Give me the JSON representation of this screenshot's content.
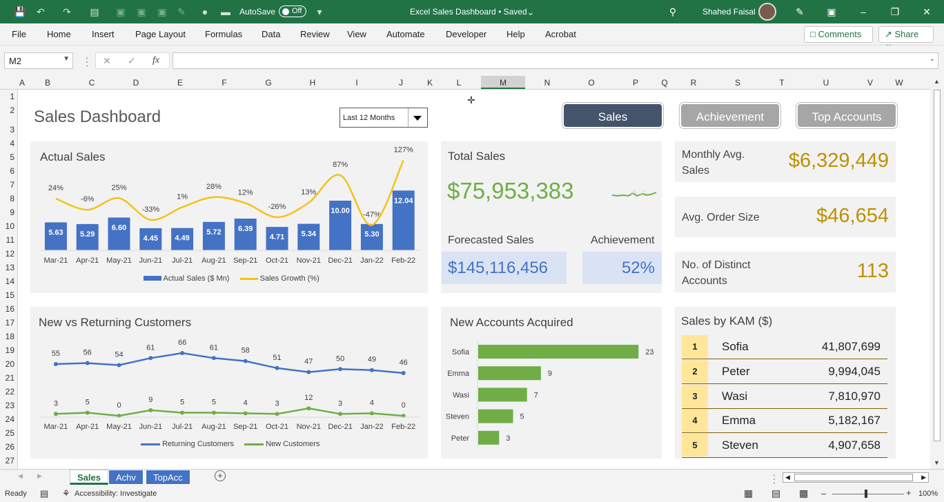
{
  "titlebar": {
    "autosave_label": "AutoSave",
    "autosave_state": "Off",
    "title": "Excel Sales Dashboard • Saved",
    "user": "Shahed Faisal"
  },
  "menu": [
    "File",
    "Home",
    "Insert",
    "Page Layout",
    "Formulas",
    "Data",
    "Review",
    "View",
    "Automate",
    "Developer",
    "Help",
    "Acrobat"
  ],
  "comments_label": "Comments",
  "share_label": "Share",
  "namebox": "M2",
  "fx_label": "fx",
  "columns": [
    "A",
    "B",
    "C",
    "D",
    "E",
    "F",
    "G",
    "H",
    "I",
    "J",
    "K",
    "L",
    "M",
    "N",
    "O",
    "P",
    "Q",
    "R",
    "S",
    "T",
    "U",
    "V",
    "W"
  ],
  "rows": [
    "1",
    "2",
    "3",
    "4",
    "5",
    "6",
    "7",
    "8",
    "9",
    "10",
    "11",
    "12",
    "13",
    "14",
    "15",
    "16",
    "17",
    "18",
    "19",
    "20",
    "21",
    "22",
    "23",
    "24",
    "25",
    "26",
    "27"
  ],
  "dashboard": {
    "title": "Sales Dashboard",
    "period": "Last 12 Months",
    "nav": [
      "Sales",
      "Achievement",
      "Top Accounts"
    ]
  },
  "actual_sales": {
    "title": "Actual Sales",
    "legend_bar": "Actual Sales ($ Mn)",
    "legend_line": "Sales Growth (%)"
  },
  "total": {
    "title": "Total Sales",
    "value": "$75,953,383",
    "forecast_label": "Forecasted Sales",
    "forecast_value": "$145,116,456",
    "achievement_label": "Achievement",
    "achievement_value": "52%"
  },
  "kpis": [
    {
      "label": "Monthly Avg. Sales",
      "value": "$6,329,449"
    },
    {
      "label": "Avg. Order Size",
      "value": "$46,654"
    },
    {
      "label": "No. of Distinct Accounts",
      "value": "113"
    }
  ],
  "customers": {
    "title": "New vs Returning Customers",
    "legend_returning": "Returning Customers",
    "legend_new": "New Customers"
  },
  "accounts": {
    "title": "New Accounts Acquired"
  },
  "kam": {
    "title": "Sales by KAM ($)",
    "rows": [
      {
        "rank": "1",
        "name": "Sofia",
        "value": "41,807,699"
      },
      {
        "rank": "2",
        "name": "Peter",
        "value": "9,994,045"
      },
      {
        "rank": "3",
        "name": "Wasi",
        "value": "7,810,970"
      },
      {
        "rank": "4",
        "name": "Emma",
        "value": "5,182,167"
      },
      {
        "rank": "5",
        "name": "Steven",
        "value": "4,907,658"
      }
    ]
  },
  "sheet_tabs": [
    "Sales",
    "Achv",
    "TopAcc"
  ],
  "status": {
    "ready": "Ready",
    "accessibility": "Accessibility: Investigate",
    "zoom": "100%"
  },
  "chart_data": [
    {
      "type": "bar",
      "title": "Actual Sales",
      "categories": [
        "Mar-21",
        "Apr-21",
        "May-21",
        "Jun-21",
        "Jul-21",
        "Aug-21",
        "Sep-21",
        "Oct-21",
        "Nov-21",
        "Dec-21",
        "Jan-22",
        "Feb-22"
      ],
      "series": [
        {
          "name": "Actual Sales ($ Mn)",
          "kind": "bar",
          "values": [
            5.63,
            5.29,
            6.6,
            4.45,
            4.49,
            5.72,
            6.39,
            4.71,
            5.34,
            10.0,
            5.3,
            12.04
          ],
          "color": "#4472c4"
        },
        {
          "name": "Sales Growth (%)",
          "kind": "line",
          "values": [
            24,
            -6,
            25,
            -33,
            1,
            28,
            12,
            -26,
            13,
            87,
            -47,
            127
          ],
          "labels": [
            "24%",
            "-6%",
            "25%",
            "-33%",
            "1%",
            "28%",
            "12%",
            "-26%",
            "13%",
            "87%",
            "-47%",
            "127%"
          ],
          "color": "#f2c318"
        }
      ]
    },
    {
      "type": "line",
      "title": "New vs Returning Customers",
      "categories": [
        "Mar-21",
        "Apr-21",
        "May-21",
        "Jun-21",
        "Jul-21",
        "Aug-21",
        "Sep-21",
        "Oct-21",
        "Nov-21",
        "Dec-21",
        "Jan-22",
        "Feb-22"
      ],
      "series": [
        {
          "name": "Returning Customers",
          "values": [
            55,
            56,
            54,
            61,
            66,
            61,
            58,
            51,
            47,
            50,
            49,
            46
          ],
          "color": "#4472c4"
        },
        {
          "name": "New Customers",
          "values": [
            3,
            5,
            0,
            9,
            5,
            5,
            4,
            3,
            12,
            3,
            4,
            0
          ],
          "color": "#70ad47"
        }
      ]
    },
    {
      "type": "bar",
      "orientation": "horizontal",
      "title": "New Accounts Acquired",
      "categories": [
        "Sofia",
        "Emma",
        "Wasi",
        "Steven",
        "Peter"
      ],
      "values": [
        23,
        9,
        7,
        5,
        3
      ],
      "color": "#70ad47"
    }
  ]
}
